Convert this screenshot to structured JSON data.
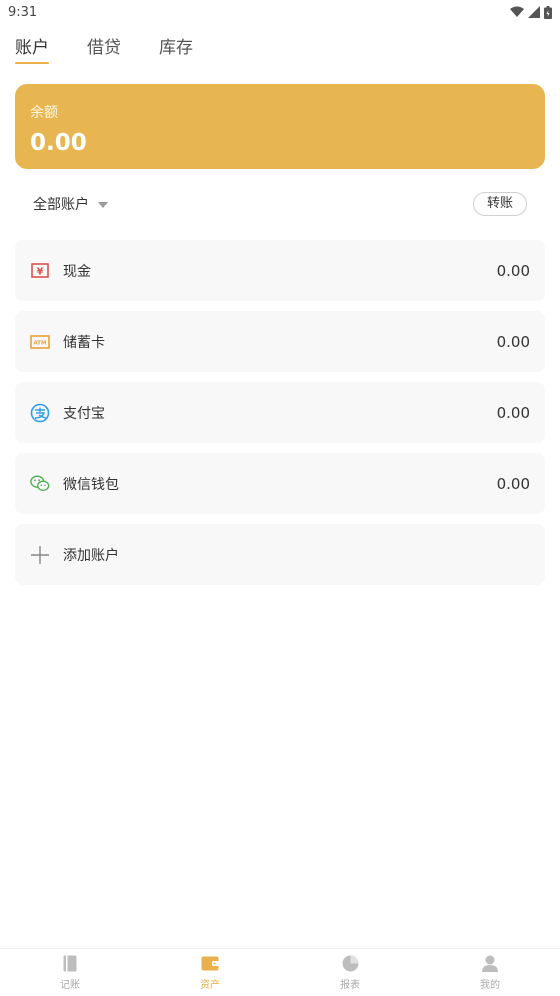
{
  "status": {
    "time": "9:31"
  },
  "tabs": [
    {
      "label": "账户",
      "active": true
    },
    {
      "label": "借贷",
      "active": false
    },
    {
      "label": "库存",
      "active": false
    }
  ],
  "balance": {
    "label": "余额",
    "value": "0.00"
  },
  "filter": {
    "label": "全部账户",
    "transfer_label": "转账"
  },
  "accounts": [
    {
      "name": "现金",
      "amount": "0.00",
      "icon": "cash-yuan-icon"
    },
    {
      "name": "储蓄卡",
      "amount": "0.00",
      "icon": "atm-card-icon"
    },
    {
      "name": "支付宝",
      "amount": "0.00",
      "icon": "alipay-icon"
    },
    {
      "name": "微信钱包",
      "amount": "0.00",
      "icon": "wechat-icon"
    }
  ],
  "add_account": {
    "label": "添加账户"
  },
  "bottom_nav": [
    {
      "label": "记账",
      "icon": "book-icon",
      "active": false
    },
    {
      "label": "资产",
      "icon": "wallet-icon",
      "active": true
    },
    {
      "label": "报表",
      "icon": "pie-chart-icon",
      "active": false
    },
    {
      "label": "我的",
      "icon": "person-icon",
      "active": false
    }
  ],
  "colors": {
    "accent": "#e8b650",
    "active_tab_underline": "#e8b14e"
  }
}
